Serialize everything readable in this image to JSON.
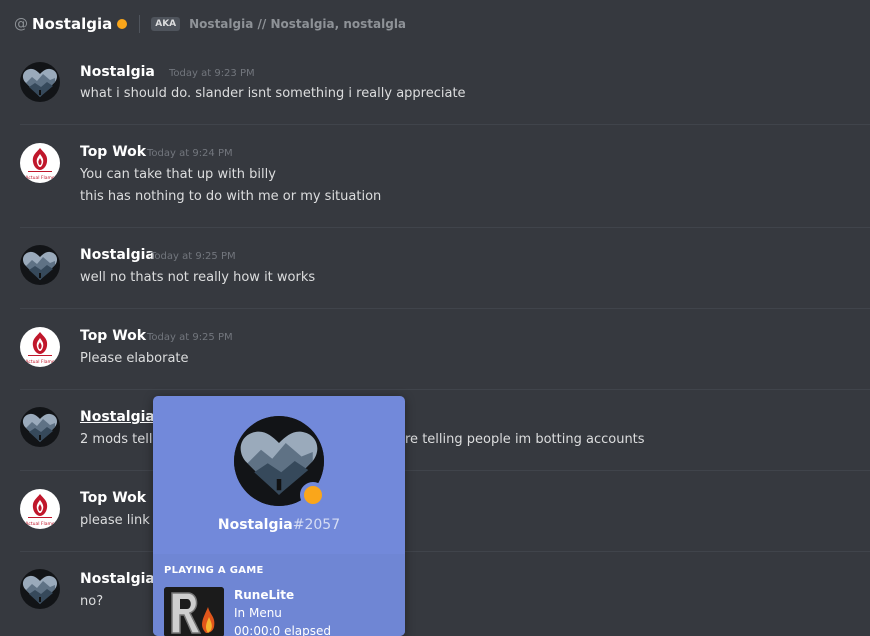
{
  "header": {
    "at_symbol": "@",
    "username": "Nostalgia",
    "status_color": "#faa61a",
    "aka_badge": "AKA",
    "aliases": "Nostalgia // Nostalgia, nostalgla"
  },
  "messages": [
    {
      "author": "Nostalgia",
      "timestamp": "Today at 9:23 PM",
      "avatar": "heart-landscape-avatar",
      "lines": [
        "what i should do. slander isnt something i really appreciate"
      ]
    },
    {
      "author": "Top Wok",
      "timestamp": "Today at 9:24 PM",
      "avatar": "flame-logo-avatar",
      "lines": [
        "You can take that up with billy",
        "this has nothing to do with me or my situation"
      ]
    },
    {
      "author": "Nostalgia",
      "timestamp": "Today at 9:25 PM",
      "avatar": "heart-landscape-avatar",
      "lines": [
        "well no thats not really how it works"
      ]
    },
    {
      "author": "Top Wok",
      "timestamp": "Today at 9:25 PM",
      "avatar": "flame-logo-avatar",
      "lines": [
        "Please elaborate"
      ]
    },
    {
      "author": "Nostalgia",
      "avatar": "heart-landscape-avatar",
      "lines": [
        "2 mods tell",
        "re telling people im botting accounts"
      ]
    },
    {
      "author": "Top Wok",
      "avatar": "flame-logo-avatar",
      "lines": [
        "please link r"
      ]
    },
    {
      "author": "Nostalgia",
      "avatar": "heart-landscape-avatar",
      "lines": [
        "no?"
      ]
    }
  ],
  "avatar_text": {
    "flame_logo": "Actual Flame"
  },
  "profile_popout": {
    "username": "Nostalgia",
    "discriminator": "#2057",
    "status_color": "#faa61a",
    "activity_header": "PLAYING A GAME",
    "game_name": "RuneLite",
    "game_state": "In Menu",
    "game_elapsed": "00:00:0 elapsed",
    "accent_color": "#7289da"
  }
}
